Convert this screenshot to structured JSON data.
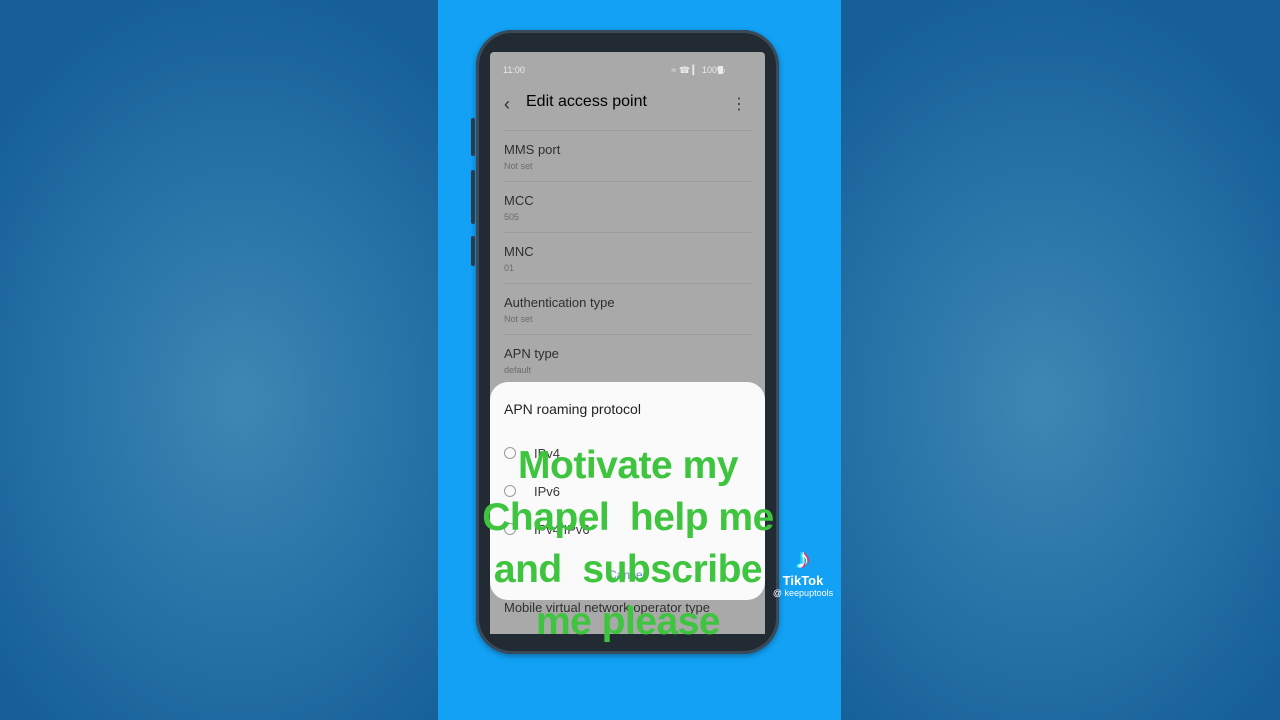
{
  "status_bar": {
    "time": "11:00",
    "icons": "≈ ☎ ▎ 100%"
  },
  "app_bar": {
    "back_glyph": "‹",
    "title": "Edit access point",
    "more_glyph": "⋮"
  },
  "settings": [
    {
      "label": "MMS port",
      "value": "Not set"
    },
    {
      "label": "MCC",
      "value": "505"
    },
    {
      "label": "MNC",
      "value": "01"
    },
    {
      "label": "Authentication type",
      "value": "Not set"
    },
    {
      "label": "APN type",
      "value": "default"
    }
  ],
  "dialog": {
    "title": "APN roaming protocol",
    "options": [
      "IPv4",
      "IPv6",
      "IPv4/IPv6"
    ],
    "cancel_label": "Cancel"
  },
  "bottom_item": {
    "label": "Mobile virtual network operator type"
  },
  "overlay_text": {
    "line1": "Motivate my",
    "line2": "Chapel  help me",
    "line3": "and  subscribe",
    "line4": "me please"
  },
  "watermark": {
    "note_glyph": "♪",
    "brand": "TikTok",
    "handle": "@ keepuptools"
  },
  "colors": {
    "overlay_text": "#3ec43e",
    "center_bg": "#12a1f5",
    "side_bg": "#1d6fa6"
  }
}
